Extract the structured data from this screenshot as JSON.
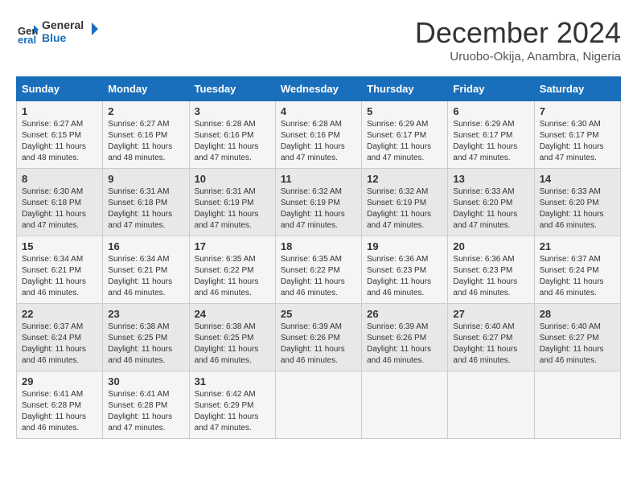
{
  "header": {
    "logo_line1": "General",
    "logo_line2": "Blue",
    "month": "December 2024",
    "location": "Uruobo-Okija, Anambra, Nigeria"
  },
  "weekdays": [
    "Sunday",
    "Monday",
    "Tuesday",
    "Wednesday",
    "Thursday",
    "Friday",
    "Saturday"
  ],
  "weeks": [
    [
      {
        "day": "1",
        "detail": "Sunrise: 6:27 AM\nSunset: 6:15 PM\nDaylight: 11 hours\nand 48 minutes."
      },
      {
        "day": "2",
        "detail": "Sunrise: 6:27 AM\nSunset: 6:16 PM\nDaylight: 11 hours\nand 48 minutes."
      },
      {
        "day": "3",
        "detail": "Sunrise: 6:28 AM\nSunset: 6:16 PM\nDaylight: 11 hours\nand 47 minutes."
      },
      {
        "day": "4",
        "detail": "Sunrise: 6:28 AM\nSunset: 6:16 PM\nDaylight: 11 hours\nand 47 minutes."
      },
      {
        "day": "5",
        "detail": "Sunrise: 6:29 AM\nSunset: 6:17 PM\nDaylight: 11 hours\nand 47 minutes."
      },
      {
        "day": "6",
        "detail": "Sunrise: 6:29 AM\nSunset: 6:17 PM\nDaylight: 11 hours\nand 47 minutes."
      },
      {
        "day": "7",
        "detail": "Sunrise: 6:30 AM\nSunset: 6:17 PM\nDaylight: 11 hours\nand 47 minutes."
      }
    ],
    [
      {
        "day": "8",
        "detail": "Sunrise: 6:30 AM\nSunset: 6:18 PM\nDaylight: 11 hours\nand 47 minutes."
      },
      {
        "day": "9",
        "detail": "Sunrise: 6:31 AM\nSunset: 6:18 PM\nDaylight: 11 hours\nand 47 minutes."
      },
      {
        "day": "10",
        "detail": "Sunrise: 6:31 AM\nSunset: 6:19 PM\nDaylight: 11 hours\nand 47 minutes."
      },
      {
        "day": "11",
        "detail": "Sunrise: 6:32 AM\nSunset: 6:19 PM\nDaylight: 11 hours\nand 47 minutes."
      },
      {
        "day": "12",
        "detail": "Sunrise: 6:32 AM\nSunset: 6:19 PM\nDaylight: 11 hours\nand 47 minutes."
      },
      {
        "day": "13",
        "detail": "Sunrise: 6:33 AM\nSunset: 6:20 PM\nDaylight: 11 hours\nand 47 minutes."
      },
      {
        "day": "14",
        "detail": "Sunrise: 6:33 AM\nSunset: 6:20 PM\nDaylight: 11 hours\nand 46 minutes."
      }
    ],
    [
      {
        "day": "15",
        "detail": "Sunrise: 6:34 AM\nSunset: 6:21 PM\nDaylight: 11 hours\nand 46 minutes."
      },
      {
        "day": "16",
        "detail": "Sunrise: 6:34 AM\nSunset: 6:21 PM\nDaylight: 11 hours\nand 46 minutes."
      },
      {
        "day": "17",
        "detail": "Sunrise: 6:35 AM\nSunset: 6:22 PM\nDaylight: 11 hours\nand 46 minutes."
      },
      {
        "day": "18",
        "detail": "Sunrise: 6:35 AM\nSunset: 6:22 PM\nDaylight: 11 hours\nand 46 minutes."
      },
      {
        "day": "19",
        "detail": "Sunrise: 6:36 AM\nSunset: 6:23 PM\nDaylight: 11 hours\nand 46 minutes."
      },
      {
        "day": "20",
        "detail": "Sunrise: 6:36 AM\nSunset: 6:23 PM\nDaylight: 11 hours\nand 46 minutes."
      },
      {
        "day": "21",
        "detail": "Sunrise: 6:37 AM\nSunset: 6:24 PM\nDaylight: 11 hours\nand 46 minutes."
      }
    ],
    [
      {
        "day": "22",
        "detail": "Sunrise: 6:37 AM\nSunset: 6:24 PM\nDaylight: 11 hours\nand 46 minutes."
      },
      {
        "day": "23",
        "detail": "Sunrise: 6:38 AM\nSunset: 6:25 PM\nDaylight: 11 hours\nand 46 minutes."
      },
      {
        "day": "24",
        "detail": "Sunrise: 6:38 AM\nSunset: 6:25 PM\nDaylight: 11 hours\nand 46 minutes."
      },
      {
        "day": "25",
        "detail": "Sunrise: 6:39 AM\nSunset: 6:26 PM\nDaylight: 11 hours\nand 46 minutes."
      },
      {
        "day": "26",
        "detail": "Sunrise: 6:39 AM\nSunset: 6:26 PM\nDaylight: 11 hours\nand 46 minutes."
      },
      {
        "day": "27",
        "detail": "Sunrise: 6:40 AM\nSunset: 6:27 PM\nDaylight: 11 hours\nand 46 minutes."
      },
      {
        "day": "28",
        "detail": "Sunrise: 6:40 AM\nSunset: 6:27 PM\nDaylight: 11 hours\nand 46 minutes."
      }
    ],
    [
      {
        "day": "29",
        "detail": "Sunrise: 6:41 AM\nSunset: 6:28 PM\nDaylight: 11 hours\nand 46 minutes."
      },
      {
        "day": "30",
        "detail": "Sunrise: 6:41 AM\nSunset: 6:28 PM\nDaylight: 11 hours\nand 47 minutes."
      },
      {
        "day": "31",
        "detail": "Sunrise: 6:42 AM\nSunset: 6:29 PM\nDaylight: 11 hours\nand 47 minutes."
      },
      {
        "day": "",
        "detail": ""
      },
      {
        "day": "",
        "detail": ""
      },
      {
        "day": "",
        "detail": ""
      },
      {
        "day": "",
        "detail": ""
      }
    ]
  ]
}
